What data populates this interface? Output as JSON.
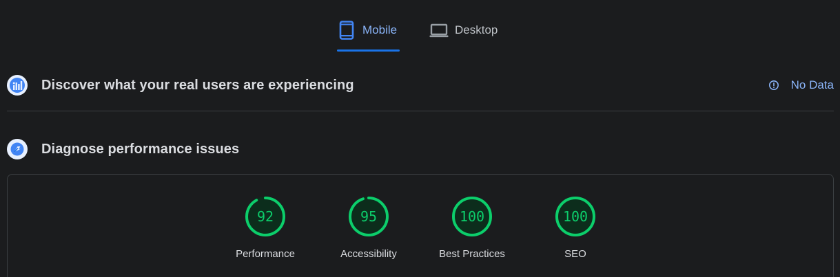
{
  "tabs": [
    {
      "label": "Mobile",
      "icon": "smartphone-icon",
      "selected": true
    },
    {
      "label": "Desktop",
      "icon": "laptop-icon",
      "selected": false
    }
  ],
  "real_users": {
    "title": "Discover what your real users are experiencing",
    "icon": "crux-users-icon",
    "status_icon": "info-icon",
    "status_label": "No Data"
  },
  "diagnose": {
    "title": "Diagnose performance issues",
    "icon": "lighthouse-icon"
  },
  "scores": [
    {
      "label": "Performance",
      "value": "92",
      "fraction": 0.92
    },
    {
      "label": "Accessibility",
      "value": "95",
      "fraction": 0.95
    },
    {
      "label": "Best Practices",
      "value": "100",
      "fraction": 1.0
    },
    {
      "label": "SEO",
      "value": "100",
      "fraction": 1.0
    }
  ],
  "colors": {
    "pass": "#0cce6b",
    "pass_fill": "#0c2d1c",
    "accent": "#8ab4f8",
    "tab_indicator": "#1a73e8",
    "background": "#1b1c1e"
  }
}
